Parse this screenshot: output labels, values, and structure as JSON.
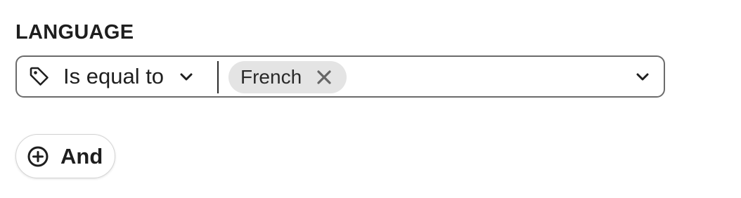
{
  "filter": {
    "label": "LANGUAGE",
    "operator": {
      "icon": "tag-icon",
      "label": "Is equal to"
    },
    "selected_values": [
      {
        "label": "French"
      }
    ]
  },
  "actions": {
    "and_button": {
      "icon": "plus-circle-icon",
      "label": "And"
    }
  },
  "colors": {
    "border": "#6b6b6b",
    "chip_background": "#e4e4e4",
    "text": "#1f1f1f"
  }
}
